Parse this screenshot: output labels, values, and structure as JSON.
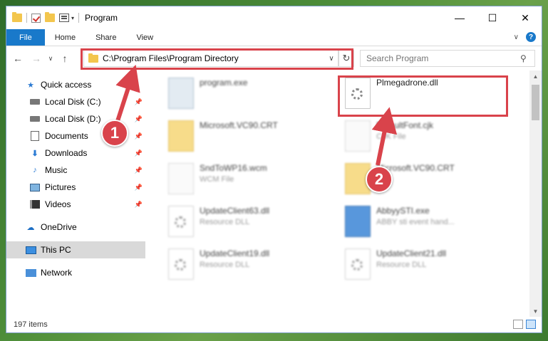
{
  "window": {
    "title": "Program"
  },
  "ribbon": {
    "tabs": [
      "File",
      "Home",
      "Share",
      "View"
    ]
  },
  "address": {
    "path": "C:\\Program Files\\Program Directory"
  },
  "search": {
    "placeholder": "Search Program"
  },
  "sidebar": {
    "items": [
      {
        "label": "Quick access",
        "icon": "star-icon"
      },
      {
        "label": "Local Disk (C:)",
        "icon": "drive-icon",
        "pinned": true
      },
      {
        "label": "Local Disk (D:)",
        "icon": "drive-icon",
        "pinned": true
      },
      {
        "label": "Documents",
        "icon": "documents-icon",
        "pinned": true
      },
      {
        "label": "Downloads",
        "icon": "downloads-icon",
        "pinned": true
      },
      {
        "label": "Music",
        "icon": "music-icon",
        "pinned": true
      },
      {
        "label": "Pictures",
        "icon": "pictures-icon",
        "pinned": true
      },
      {
        "label": "Videos",
        "icon": "videos-icon",
        "pinned": true
      },
      {
        "label": "OneDrive",
        "icon": "onedrive-icon"
      },
      {
        "label": "This PC",
        "icon": "this-pc-icon",
        "selected": true
      },
      {
        "label": "Network",
        "icon": "network-icon"
      }
    ]
  },
  "files": [
    {
      "name": "program.exe",
      "type": "",
      "icon": "exe-icon"
    },
    {
      "name": "Plmegadrone.dll",
      "type": "",
      "icon": "dll-icon"
    },
    {
      "name": "Microsoft.VC90.CRT",
      "type": "",
      "icon": "folder-icon"
    },
    {
      "name": "DefaultFont.cjk",
      "type": "CJK File",
      "icon": "file-icon"
    },
    {
      "name": "SndToWP16.wcm",
      "type": "WCM File",
      "icon": "file-icon"
    },
    {
      "name": "Microsoft.VC90.CRT",
      "type": "",
      "icon": "folder-icon"
    },
    {
      "name": "UpdateClient63.dll",
      "type": "Resource DLL",
      "icon": "dll-icon"
    },
    {
      "name": "AbbyySTI.exe",
      "type": "ABBY sti event hand...",
      "icon": "exe-icon"
    },
    {
      "name": "UpdateClient19.dll",
      "type": "Resource DLL",
      "icon": "dll-icon"
    },
    {
      "name": "UpdateClient21.dll",
      "type": "Resource DLL",
      "icon": "dll-icon"
    }
  ],
  "status": {
    "count": "197 items"
  },
  "callouts": {
    "one": "1",
    "two": "2"
  },
  "colors": {
    "accent": "#1979ca",
    "highlight": "#d9434b"
  }
}
